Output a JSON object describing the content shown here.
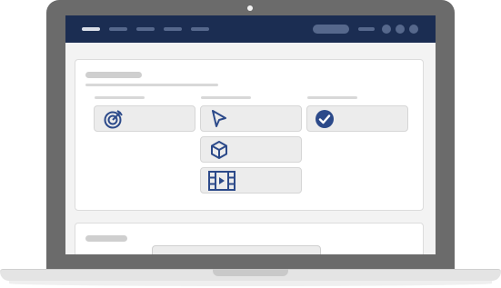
{
  "navbar": {
    "background": "#1b2d52",
    "items": [
      "nav-item-1",
      "nav-item-2",
      "nav-item-3",
      "nav-item-4",
      "nav-item-5"
    ],
    "actions": [
      "action-button",
      "action-link",
      "dot-1",
      "dot-2",
      "dot-3"
    ]
  },
  "content": {
    "columns": [
      {
        "tiles": [
          {
            "icon": "target-icon"
          }
        ]
      },
      {
        "tiles": [
          {
            "icon": "cursor-arrow-icon"
          },
          {
            "icon": "cube-icon"
          },
          {
            "icon": "video-film-icon"
          }
        ]
      },
      {
        "tiles": [
          {
            "icon": "check-circle-icon"
          }
        ]
      }
    ]
  },
  "colors": {
    "accent": "#2c4a8a",
    "tile_bg": "#ececec",
    "placeholder": "#cfcfcf"
  }
}
